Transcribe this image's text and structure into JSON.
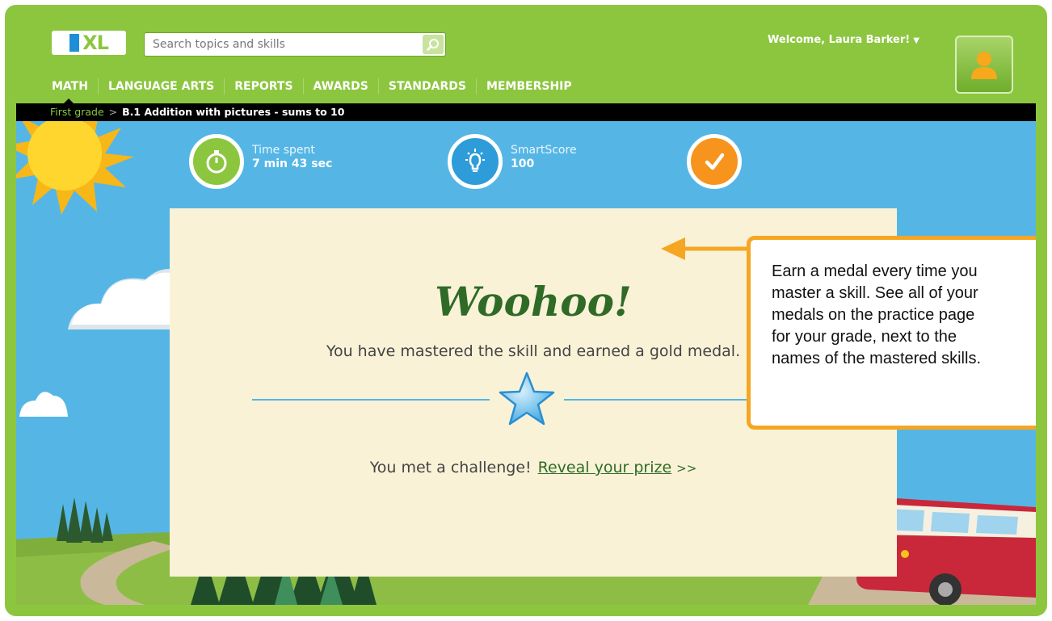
{
  "header": {
    "logo_text": "IXL",
    "search_placeholder": "Search topics and skills",
    "welcome_text": "Welcome, Laura Barker!",
    "nav": [
      "MATH",
      "LANGUAGE ARTS",
      "REPORTS",
      "AWARDS",
      "STANDARDS",
      "MEMBERSHIP"
    ],
    "active_nav": "MATH"
  },
  "breadcrumb": {
    "grade": "First grade",
    "separator": ">",
    "skill": "B.1 Addition with pictures - sums to 10"
  },
  "stats": {
    "time_label": "Time spent",
    "time_value": "7 min 43 sec",
    "score_label": "SmartScore",
    "score_value": "100"
  },
  "card": {
    "heading": "Woohoo!",
    "mastered_text": "You have mastered the skill and earned a gold medal.",
    "challenge_text": "You met a challenge!",
    "reveal_link": "Reveal your prize",
    "reveal_arrows": ">>"
  },
  "tooltip": {
    "lines": [
      "Earn a medal every time you",
      "master a skill. See all of your",
      "medals on the practice page",
      "for your grade, next to the",
      "names of the mastered skills."
    ]
  },
  "colors": {
    "brand_green": "#8cc63f",
    "sky": "#55b6e6",
    "card_bg": "#f9f2d7",
    "callout_orange": "#f5a623",
    "heading_green": "#2f6b27",
    "stat_green": "#8cc63f",
    "stat_blue": "#2e9cd8",
    "stat_orange": "#f7941d"
  }
}
